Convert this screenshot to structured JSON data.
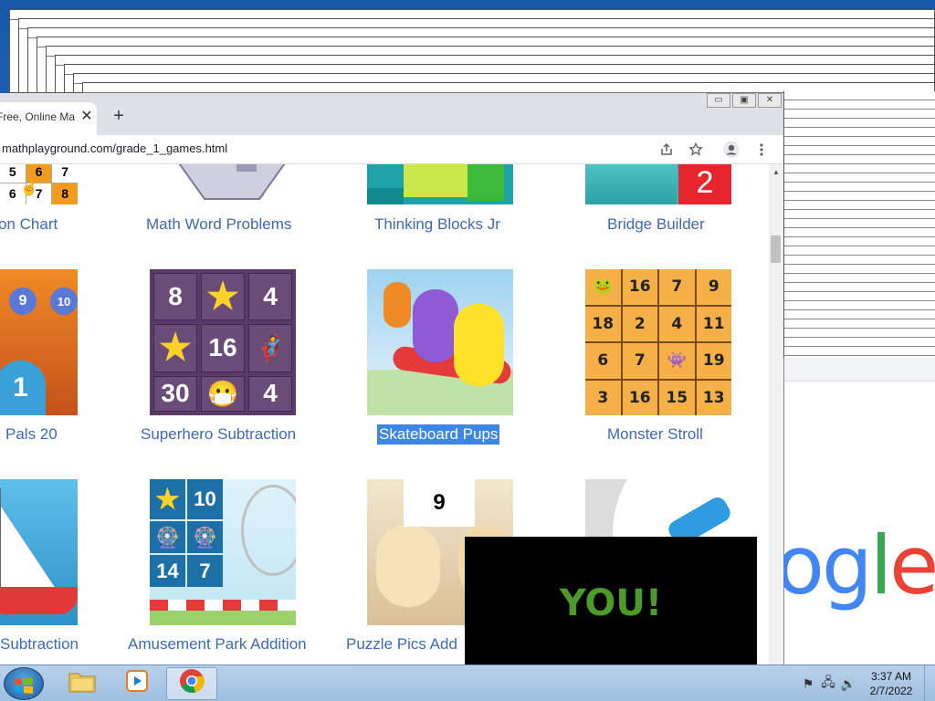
{
  "browser": {
    "tab_title": "Free, Online Ma",
    "new_tab_label": "+",
    "url": "mathplayground.com/grade_1_games.html"
  },
  "window_buttons": [
    "▭",
    "▣",
    "✕"
  ],
  "games_row1": [
    {
      "label": "Multiplication Chart",
      "visible_label": "on Chart"
    },
    {
      "label": "Math Word Problems"
    },
    {
      "label": "Thinking Blocks Jr"
    },
    {
      "label": "Bridge Builder"
    }
  ],
  "games_row2": [
    {
      "label": "Pals 20"
    },
    {
      "label": "Superhero Subtraction"
    },
    {
      "label": "Skateboard Pups"
    },
    {
      "label": "Monster Stroll"
    }
  ],
  "games_row3": [
    {
      "label": "Subtraction"
    },
    {
      "label": "Amusement Park Addition"
    },
    {
      "label": "Puzzle Pics Add"
    }
  ],
  "thumb_text": {
    "chart_cells": [
      "5",
      "6",
      "7",
      "6",
      "7",
      "8"
    ],
    "bridge_number": "2",
    "pals_numbers": [
      "9",
      "10",
      "1"
    ],
    "superhero_cells": [
      "8",
      "★",
      "4",
      "★",
      "16",
      "🦸",
      "30",
      "😷",
      "4"
    ],
    "monster_cells": [
      "🐸",
      "16",
      "7",
      "9",
      "18",
      "2",
      "4",
      "11",
      "6",
      "7",
      "👾",
      "19",
      "3",
      "16",
      "15",
      "13"
    ],
    "amusement_cells": [
      "★",
      "10",
      "🎡",
      "🎡",
      "14",
      "7"
    ],
    "puzzle_number": "9"
  },
  "video_overlay": {
    "text": "YOU!"
  },
  "google_logo": {
    "letters": [
      "o",
      "g",
      "l",
      "e"
    ],
    "colors": [
      "#4285f4",
      "#4285f4",
      "#34a853",
      "#ea4335"
    ]
  },
  "taskbar": {
    "time": "3:37 AM",
    "date": "2/7/2022"
  },
  "colors": {
    "link": "#3d6ab6",
    "selection": "#3d86e6",
    "video_text": "#4c9a2a"
  }
}
